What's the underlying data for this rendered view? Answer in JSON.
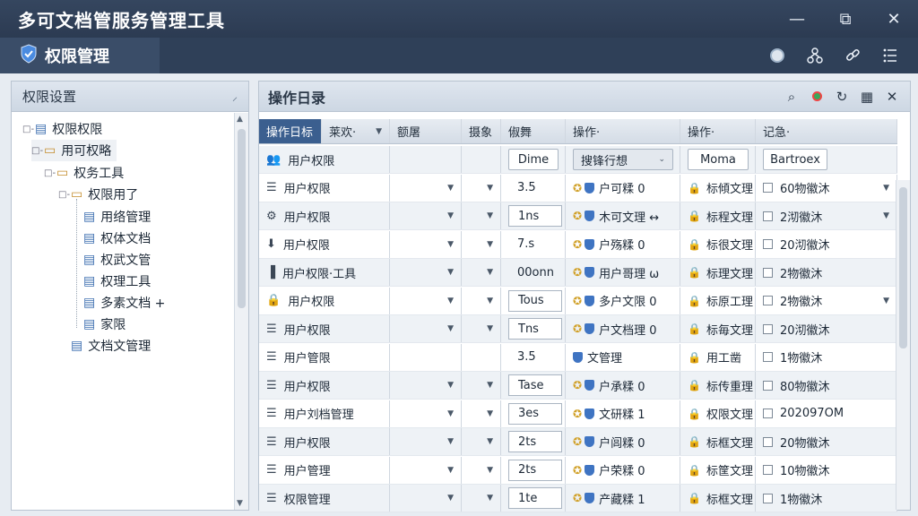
{
  "window": {
    "title": "多可文档管服务管理工具",
    "minimize": "—",
    "maximize": "⧉",
    "close": "✕"
  },
  "module": {
    "title": "权限管理",
    "icons": [
      "status-icon",
      "network-icon",
      "link-icon",
      "settings-list-icon"
    ]
  },
  "left": {
    "title": "权限设置",
    "pin": "⸝",
    "tree": [
      {
        "label": "权限权限",
        "icon": "page",
        "expand": "□-"
      },
      {
        "label": "用可权略",
        "icon": "folder",
        "expand": "□-",
        "selected": true
      },
      {
        "label": "权务工具",
        "icon": "folder",
        "expand": "□-"
      },
      {
        "label": "权限用了",
        "icon": "folder",
        "expand": "□-"
      },
      {
        "label": "用络管理",
        "icon": "doc"
      },
      {
        "label": "权体文档",
        "icon": "doc"
      },
      {
        "label": "权武文管",
        "icon": "doc"
      },
      {
        "label": "权理工具",
        "icon": "doc"
      },
      {
        "label": "多素文档 +",
        "icon": "doc"
      },
      {
        "label": "家限",
        "icon": "doc"
      },
      {
        "label": "文档文管理",
        "icon": "doc"
      }
    ]
  },
  "right": {
    "title": "操作日录",
    "headers": [
      "操作日标",
      "莱欢·",
      "额屠",
      "摄象",
      "俶舞",
      "操作·",
      "操作·",
      "记急·"
    ],
    "filter": {
      "col1": "用户权限",
      "btn1": "Dime",
      "btn2": "搜锋行想",
      "btn3": "Moma",
      "btn4": "Bartroex"
    },
    "rows": [
      {
        "name": "用户权限",
        "val": "3.5",
        "op1": "户可糅 0",
        "op2": "标傾文理",
        "rec": "60物徽沐"
      },
      {
        "name": "用户权限",
        "val": "1ns",
        "op1": "木可文理 ↔",
        "op2": "标程文理",
        "rec": "2沏徽沐"
      },
      {
        "name": "用户权限",
        "val": "7.s",
        "op1": "户殇糅 0",
        "op2": "标很文理",
        "rec": "20沏徽沐"
      },
      {
        "name": "用户权限·工具",
        "val": "00onn",
        "op1": "用户哥理 ω",
        "op2": "标理文理",
        "rec": "2物徽沐"
      },
      {
        "name": "用户权限",
        "val": "Tous",
        "op1": "多户文限 0",
        "op2": "标原工理",
        "rec": "2物徽沐"
      },
      {
        "name": "用户权限",
        "val": "Tns",
        "op1": "户文档理 0",
        "op2": "标毎文理",
        "rec": "20沏徽沐"
      },
      {
        "name": "用户管限",
        "val": "3.5",
        "op1": "文管理",
        "op2": "用工凿",
        "rec": "1物徽沐"
      },
      {
        "name": "用户权限",
        "val": "Tase",
        "op1": "户承糅 0",
        "op2": "标传重理",
        "rec": "80物徽沐"
      },
      {
        "name": "用户刘档管理",
        "val": "3es",
        "op1": "文研糅 1",
        "op2": "权限文理",
        "rec": "202097OM"
      },
      {
        "name": "用户权限",
        "val": "2ts",
        "op1": "户闾糅 0",
        "op2": "标框文理",
        "rec": "20物徽沐"
      },
      {
        "name": "用户管理",
        "val": "2ts",
        "op1": "户荣糅 0",
        "op2": "标筐文理",
        "rec": "10物徽沐"
      },
      {
        "name": "权限管理",
        "val": "1te",
        "op1": "产藏糅 1",
        "op2": "标框文理",
        "rec": "1物徽沐"
      }
    ]
  }
}
